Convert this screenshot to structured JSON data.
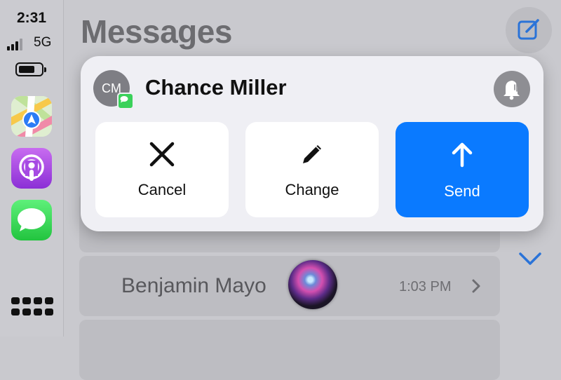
{
  "status": {
    "time": "2:31",
    "network": "5G"
  },
  "dock": {
    "apps": [
      {
        "name": "Maps",
        "icon": "maps-icon"
      },
      {
        "name": "Podcasts",
        "icon": "podcasts-icon"
      },
      {
        "name": "Messages",
        "icon": "messages-icon"
      }
    ],
    "launcher_icon": "app-grid-icon"
  },
  "messages": {
    "title": "Messages",
    "compose_icon": "compose-icon",
    "rows": [
      {
        "name": "",
        "time": ""
      },
      {
        "name": "Benjamin Mayo",
        "time": "1:03 PM"
      },
      {
        "name": "",
        "time": ""
      }
    ]
  },
  "siri_card": {
    "contact_initials": "CM",
    "contact_name": "Chance Miller",
    "announce_icon": "bell-announce-icon",
    "actions": [
      {
        "label": "Cancel",
        "icon": "close-icon"
      },
      {
        "label": "Change",
        "icon": "pencil-icon"
      },
      {
        "label": "Send",
        "icon": "arrow-up-icon"
      }
    ]
  },
  "colors": {
    "accent": "#0A7AFF",
    "messages_green": "#34C759",
    "dimmed_background": "#C9C9CE",
    "card_background": "#EFEFF4"
  }
}
